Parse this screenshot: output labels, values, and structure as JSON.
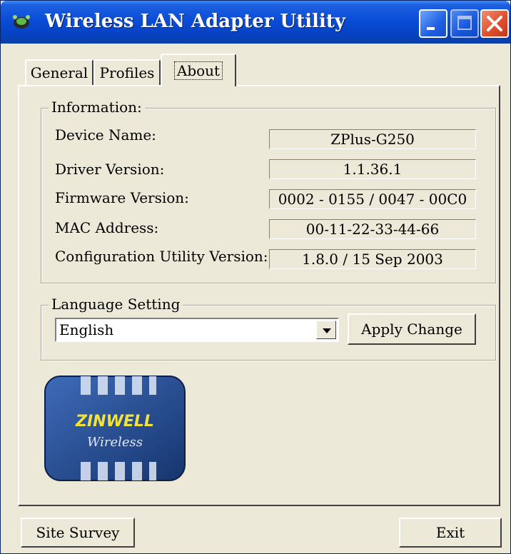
{
  "window": {
    "title": "Wireless LAN Adapter Utility",
    "colors": {
      "titlebar": "#0a4dd8",
      "face": "#ece9d8",
      "close": "#e05030"
    }
  },
  "tabs": [
    {
      "label": "General",
      "selected": false
    },
    {
      "label": "Profiles",
      "selected": false
    },
    {
      "label": "About",
      "selected": true
    }
  ],
  "information": {
    "legend": "Information:",
    "rows": [
      {
        "label": "Device Name:",
        "value": "ZPlus-G250"
      },
      {
        "label": "Driver Version:",
        "value": "1.1.36.1"
      },
      {
        "label": "Firmware Version:",
        "value": "0002 - 0155 / 0047 - 00C0"
      },
      {
        "label": "MAC Address:",
        "value": "00-11-22-33-44-66"
      },
      {
        "label": "Configuration Utility Version:",
        "value": "1.8.0 / 15 Sep 2003"
      }
    ]
  },
  "language": {
    "legend": "Language Setting",
    "selected": "English",
    "apply_label": "Apply Change"
  },
  "logo": {
    "brand": "ZINWELL",
    "tagline": "Wireless"
  },
  "footer": {
    "site_survey_label": "Site Survey",
    "exit_label": "Exit"
  }
}
